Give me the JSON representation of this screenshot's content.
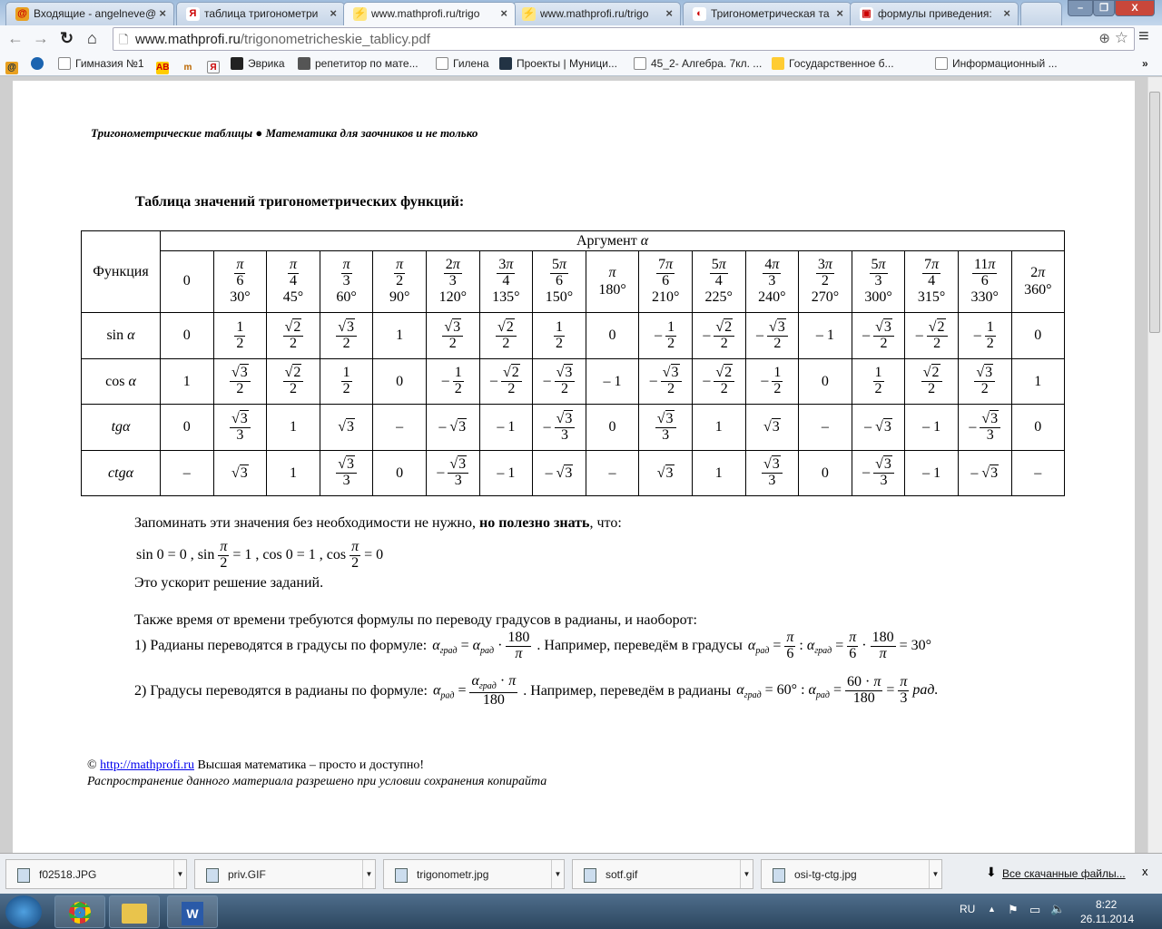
{
  "browser": {
    "tabs": [
      {
        "title": "Входящие - angelneve@",
        "icon": "mail-icon",
        "active": false
      },
      {
        "title": "таблица тригонометри",
        "icon": "yandex-icon",
        "active": false
      },
      {
        "title": "www.mathprofi.ru/trigo",
        "icon": "mathprofi-icon",
        "active": true
      },
      {
        "title": "www.mathprofi.ru/trigo",
        "icon": "mathprofi-icon",
        "active": false
      },
      {
        "title": "Тригонометрическая та",
        "icon": "site-icon",
        "active": false
      },
      {
        "title": "формулы приведения: ",
        "icon": "image-icon",
        "active": false
      }
    ],
    "url_host": "www.mathprofi.ru",
    "url_path": "/trigonometricheskie_tablicy.pdf",
    "bookmarks": [
      "Гимназия №1",
      "Эврика",
      "репетитор по мате...",
      "Гилена",
      "Проекты | Муници...",
      "45_2- Алгебра. 7кл. ...",
      "Государственное б...",
      "Информационный ..."
    ],
    "more": "»"
  },
  "doc": {
    "header": "Тригонометрические таблицы ● Математика для заочников и не только",
    "title": "Таблица значений тригонометрических функций:",
    "table": {
      "func_header": "Функция",
      "arg_header": "Аргумент α",
      "radians": [
        "0",
        "π/6",
        "π/4",
        "π/3",
        "π/2",
        "2π/3",
        "3π/4",
        "5π/6",
        "π",
        "7π/6",
        "5π/4",
        "4π/3",
        "3π/2",
        "5π/3",
        "7π/4",
        "11π/6",
        "2π"
      ],
      "degrees": [
        "",
        "30°",
        "45°",
        "60°",
        "90°",
        "120°",
        "135°",
        "150°",
        "180°",
        "210°",
        "225°",
        "240°",
        "270°",
        "300°",
        "315°",
        "330°",
        "360°"
      ],
      "rows": [
        {
          "name": "sin α",
          "italic": false,
          "values": [
            "0",
            "1/2",
            "√2/2",
            "√3/2",
            "1",
            "√3/2",
            "√2/2",
            "1/2",
            "0",
            "-1/2",
            "-√2/2",
            "-√3/2",
            "-1",
            "-√3/2",
            "-√2/2",
            "-1/2",
            "0"
          ]
        },
        {
          "name": "cos α",
          "italic": false,
          "values": [
            "1",
            "√3/2",
            "√2/2",
            "1/2",
            "0",
            "-1/2",
            "-√2/2",
            "-√3/2",
            "-1",
            "-√3/2",
            "-√2/2",
            "-1/2",
            "0",
            "1/2",
            "√2/2",
            "√3/2",
            "1"
          ]
        },
        {
          "name": "tgα",
          "italic": true,
          "values": [
            "0",
            "√3/3",
            "1",
            "√3",
            "–",
            "-√3",
            "-1",
            "-√3/3",
            "0",
            "√3/3",
            "1",
            "√3",
            "–",
            "-√3",
            "-1",
            "-√3/3",
            "0"
          ]
        },
        {
          "name": "ctgα",
          "italic": true,
          "values": [
            "–",
            "√3",
            "1",
            "√3/3",
            "0",
            "-√3/3",
            "-1",
            "-√3",
            "–",
            "√3",
            "1",
            "√3/3",
            "0",
            "-√3/3",
            "-1",
            "-√3",
            "–"
          ]
        }
      ]
    },
    "remember": "Запоминать эти значения без необходимости не нужно, ",
    "remember_bold": "но полезно знать",
    "remember_end": ", что:",
    "basic": "sin 0 = 0 ,  sin π/2 = 1 ,  cos 0 = 1 ,  cos π/2 = 0",
    "speedup": "Это ускорит решение заданий.",
    "also": "Также время от времени требуются формулы по переводу градусов в радианы, и наоборот:",
    "f1_text": "1) Радианы переводятся в градусы по формуле:",
    "f1_formula": "α_град = α_рад · 180/π",
    "f1_example": ". Например, переведём в градусы",
    "f1_example_formula": "α_рад = π/6 :  α_град = π/6 · 180/π = 30°",
    "f2_text": "2) Градусы переводятся в радианы по формуле:",
    "f2_formula": "α_рад = α_град · π / 180",
    "f2_example": ". Например, переведём в радианы",
    "f2_example_formula": "α_град = 60° :  α_рад = 60·π/180 = π/3 рад.",
    "copy_sign": "©",
    "copy_link": "http://mathprofi.ru",
    "copy_text": " Высшая математика – просто и доступно!",
    "copy_note": "Распространение данного материала разрешено при условии сохранения копирайта"
  },
  "downloads": {
    "items": [
      "f02518.JPG",
      "priv.GIF",
      "trigonometr.jpg",
      "sotf.gif",
      "osi-tg-ctg.jpg"
    ],
    "all": "Все скачанные файлы...",
    "close": "x"
  },
  "taskbar": {
    "lang": "RU",
    "time": "8:22",
    "date": "26.11.2014"
  }
}
